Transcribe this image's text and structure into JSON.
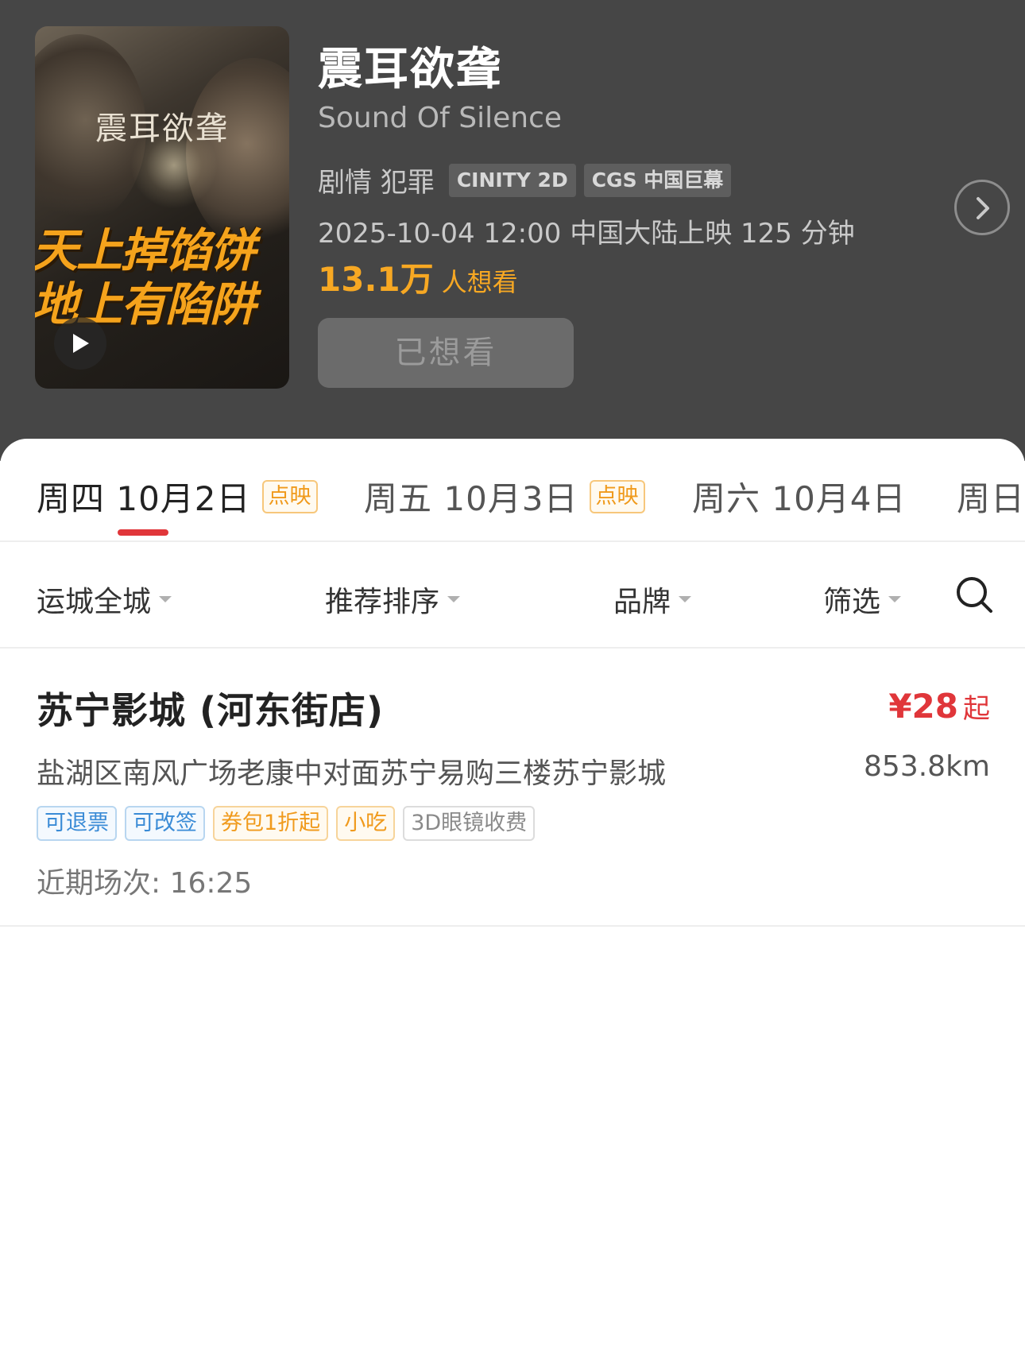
{
  "movie": {
    "poster": {
      "title_art": "震耳欲聋",
      "slogan_line1": "天上掉馅饼",
      "slogan_line2": "地上有陷阱"
    },
    "title": "震耳欲聋",
    "english_title": "Sound Of Silence",
    "genres": "剧情 犯罪",
    "formats": [
      "CINITY 2D",
      "CGS 中国巨幕"
    ],
    "release_info": "2025-10-04 12:00 中国大陆上映 125 分钟",
    "want_count": "13.1万",
    "want_label": "人想看",
    "wanted_button": "已想看"
  },
  "date_tabs": [
    {
      "label": "周四 10月2日",
      "badge": "点映"
    },
    {
      "label": "周五 10月3日",
      "badge": "点映"
    },
    {
      "label": "周六 10月4日",
      "badge": ""
    },
    {
      "label": "周日",
      "badge": ""
    }
  ],
  "filters": {
    "region": "运城全城",
    "sort": "推荐排序",
    "brand": "品牌",
    "filter": "筛选"
  },
  "cinema": {
    "name": "苏宁影城 (河东街店)",
    "price": "¥28",
    "price_suffix": "起",
    "address": "盐湖区南风广场老康中对面苏宁易购三楼苏宁影城",
    "distance": "853.8km",
    "tags": [
      "可退票",
      "可改签",
      "券包1折起",
      "小吃",
      "3D眼镜收费"
    ],
    "showtimes": "近期场次: 16:25"
  },
  "colors": {
    "header_bg": "#464646",
    "accent_red": "#e0363a",
    "want_orange": "#f7a823"
  },
  "icons": [
    "play-icon",
    "chevron-right-icon",
    "search-icon",
    "caret-down-icon"
  ]
}
